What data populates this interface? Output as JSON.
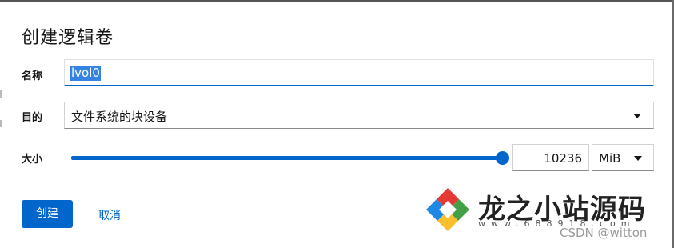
{
  "dialog": {
    "title": "创建逻辑卷"
  },
  "form": {
    "name": {
      "label": "名称",
      "value": "lvol0"
    },
    "purpose": {
      "label": "目的",
      "value": "文件系统的块设备"
    },
    "size": {
      "label": "大小",
      "value": "10236",
      "unit": "MiB",
      "slider_fraction": 1.0
    }
  },
  "actions": {
    "create_label": "创建",
    "cancel_label": "取消"
  },
  "watermark": {
    "site_name": "龙之小站源码",
    "site_url": "www.688918.com",
    "credit": "CSDN @witton"
  },
  "colors": {
    "accent": "#0066cc",
    "selection": "#3584e4",
    "text": "#151515"
  },
  "icons": {
    "select_caret": "caret-down-icon",
    "watermark_logo": "diamond-logo"
  }
}
